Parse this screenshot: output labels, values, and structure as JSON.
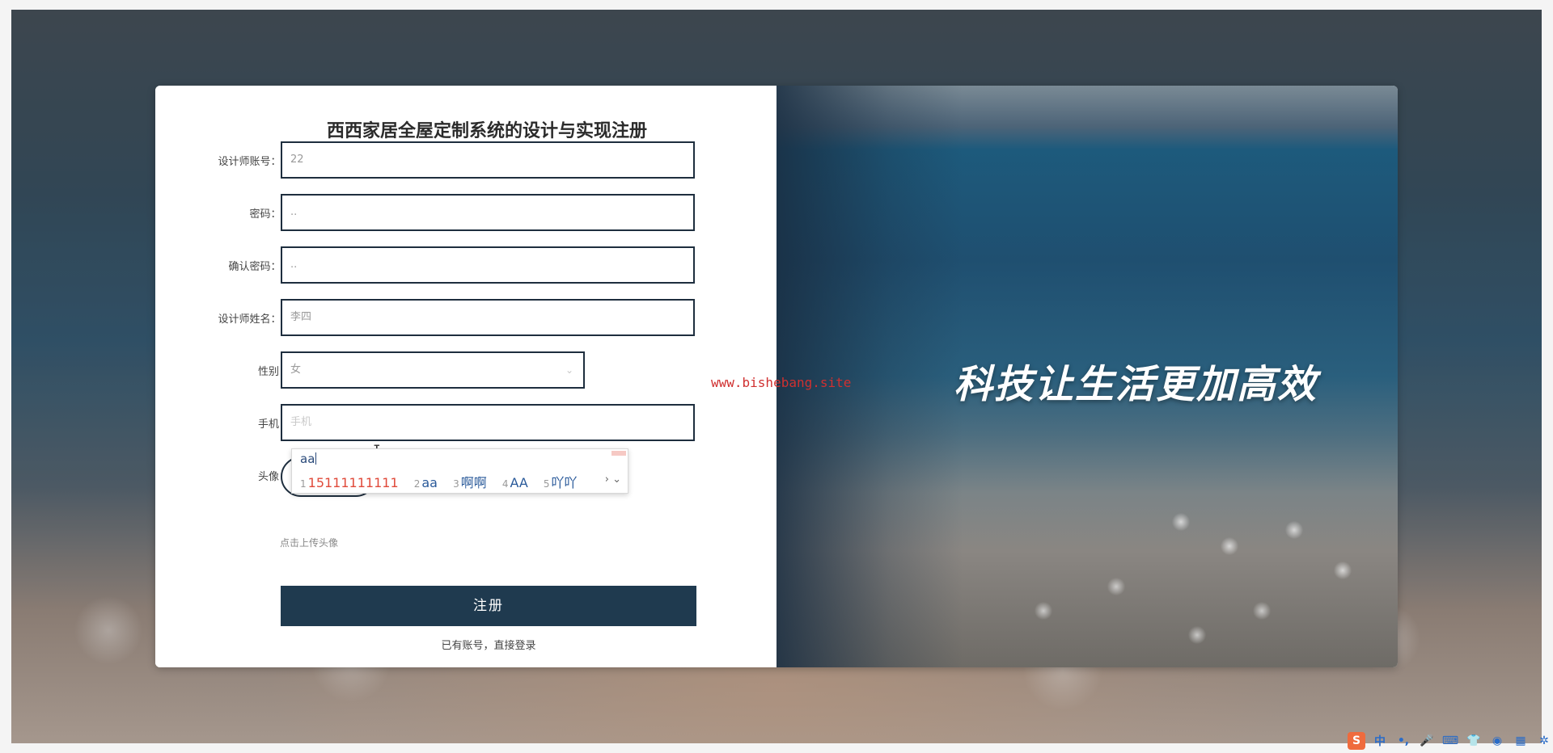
{
  "app": {
    "form_title": "西西家居全屋定制系统的设计与实现注册",
    "slogan": "科技让生活更加高效",
    "watermark": "www.bishebang.site"
  },
  "form": {
    "fields": [
      {
        "label": "设计师账号：",
        "required": true,
        "value": "22"
      },
      {
        "label": "密码：",
        "required": true,
        "value": ".."
      },
      {
        "label": "确认密码：",
        "required": true,
        "value": ".."
      },
      {
        "label": "设计师姓名：",
        "required": true,
        "value": "李四"
      },
      {
        "label": "性别：",
        "required": false,
        "value": "女"
      },
      {
        "label": "手机：",
        "required": false,
        "placeholder": "手机"
      },
      {
        "label": "头像：",
        "required": false
      }
    ],
    "required_mark": "*",
    "avatar_plus": "+",
    "avatar_hint": "点击上传头像",
    "submit_label": "注册",
    "login_link": "已有账号，直接登录",
    "select_chevron": "⌄"
  },
  "ime": {
    "typed": "aa",
    "candidates": [
      {
        "n": "1",
        "text": "15111111111"
      },
      {
        "n": "2",
        "text": "aa"
      },
      {
        "n": "3",
        "text": "啊啊"
      },
      {
        "n": "4",
        "text": "AA"
      },
      {
        "n": "5",
        "text": "吖吖"
      }
    ],
    "nav": "›  ⌄"
  },
  "tray": {
    "items": [
      {
        "icon": "sogou-icon",
        "glyph": "S"
      },
      {
        "icon": "chinese-mode-icon",
        "glyph": "中"
      },
      {
        "icon": "punctuation-icon",
        "glyph": "•,"
      },
      {
        "icon": "mic-icon",
        "glyph": "🎤"
      },
      {
        "icon": "keyboard-icon",
        "glyph": "⌨"
      },
      {
        "icon": "skin-icon",
        "glyph": "👕"
      },
      {
        "icon": "robot-icon",
        "glyph": "◉"
      },
      {
        "icon": "grid-icon",
        "glyph": "▦"
      },
      {
        "icon": "settings-icon",
        "glyph": "✲"
      }
    ]
  },
  "colors": {
    "accent": "#1f3a4f",
    "required": "#e23c3c",
    "watermark": "#d03030"
  }
}
